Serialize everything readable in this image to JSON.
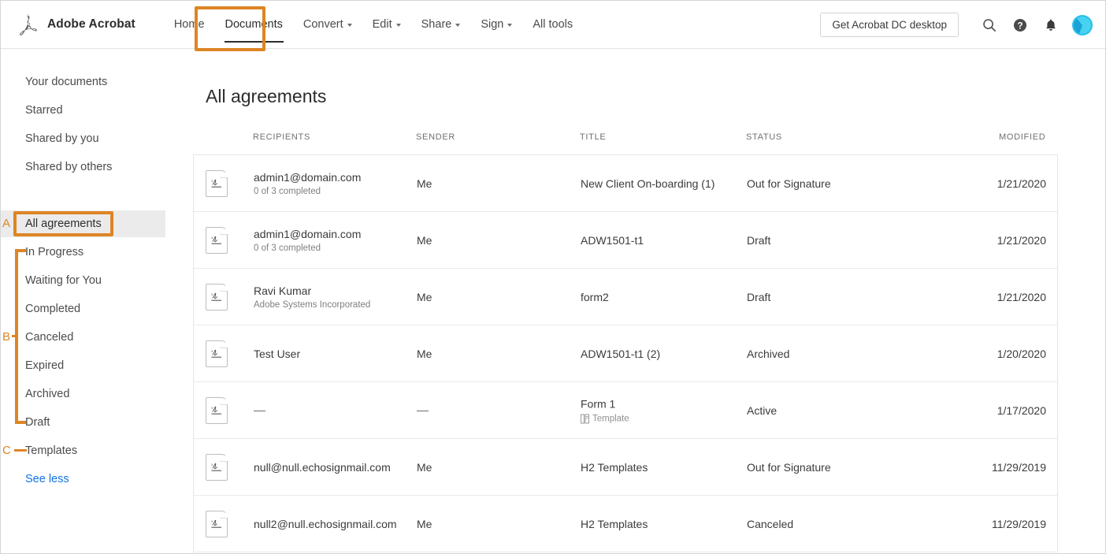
{
  "header": {
    "brand": "Adobe Acrobat",
    "logo_icon": "acrobat-logo-icon",
    "nav": [
      {
        "label": "Home",
        "has_caret": false,
        "active": false
      },
      {
        "label": "Documents",
        "has_caret": false,
        "active": true
      },
      {
        "label": "Convert",
        "has_caret": true,
        "active": false
      },
      {
        "label": "Edit",
        "has_caret": true,
        "active": false
      },
      {
        "label": "Share",
        "has_caret": true,
        "active": false
      },
      {
        "label": "Sign",
        "has_caret": true,
        "active": false
      },
      {
        "label": "All tools",
        "has_caret": false,
        "active": false
      }
    ],
    "get_desktop_label": "Get Acrobat DC desktop",
    "icons": [
      "search-icon",
      "help-icon",
      "bell-icon",
      "avatar"
    ]
  },
  "sidebar": {
    "items": [
      {
        "label": "Your documents",
        "selected": false,
        "link": false
      },
      {
        "label": "Starred",
        "selected": false,
        "link": false
      },
      {
        "label": "Shared by you",
        "selected": false,
        "link": false
      },
      {
        "label": "Shared by others",
        "selected": false,
        "link": false
      },
      {
        "label": "All agreements",
        "selected": true,
        "link": false
      },
      {
        "label": "In Progress",
        "selected": false,
        "link": false
      },
      {
        "label": "Waiting for You",
        "selected": false,
        "link": false
      },
      {
        "label": "Completed",
        "selected": false,
        "link": false
      },
      {
        "label": "Canceled",
        "selected": false,
        "link": false
      },
      {
        "label": "Expired",
        "selected": false,
        "link": false
      },
      {
        "label": "Archived",
        "selected": false,
        "link": false
      },
      {
        "label": "Draft",
        "selected": false,
        "link": false
      },
      {
        "label": "Templates",
        "selected": false,
        "link": false
      },
      {
        "label": "See less",
        "selected": false,
        "link": true
      }
    ]
  },
  "main": {
    "title": "All agreements",
    "columns": {
      "recipients": "RECIPIENTS",
      "sender": "SENDER",
      "title": "TITLE",
      "status": "STATUS",
      "modified": "MODIFIED"
    },
    "rows": [
      {
        "icon": "agreement-doc-icon",
        "recipient": "admin1@domain.com",
        "recipient_sub": "0 of 3 completed",
        "sender": "Me",
        "title": "New Client On-boarding (1)",
        "title_sub": "",
        "status": "Out for Signature",
        "modified": "1/21/2020"
      },
      {
        "icon": "agreement-doc-icon",
        "recipient": "admin1@domain.com",
        "recipient_sub": "0 of 3 completed",
        "sender": "Me",
        "title": "ADW1501-t1",
        "title_sub": "",
        "status": "Draft",
        "modified": "1/21/2020"
      },
      {
        "icon": "agreement-doc-icon",
        "recipient": "Ravi Kumar",
        "recipient_sub": "Adobe Systems Incorporated",
        "sender": "Me",
        "title": "form2",
        "title_sub": "",
        "status": "Draft",
        "modified": "1/21/2020"
      },
      {
        "icon": "agreement-doc-icon",
        "recipient": "Test User",
        "recipient_sub": "",
        "sender": "Me",
        "title": "ADW1501-t1 (2)",
        "title_sub": "",
        "status": "Archived",
        "modified": "1/20/2020"
      },
      {
        "icon": "agreement-doc-icon",
        "recipient": "—",
        "recipient_sub": "",
        "sender": "—",
        "title": "Form 1",
        "title_sub": "Template",
        "status": "Active",
        "modified": "1/17/2020"
      },
      {
        "icon": "agreement-doc-icon",
        "recipient": "null@null.echosignmail.com",
        "recipient_sub": "",
        "sender": "Me",
        "title": "H2 Templates",
        "title_sub": "",
        "status": "Out for Signature",
        "modified": "11/29/2019"
      },
      {
        "icon": "agreement-doc-icon",
        "recipient": "null2@null.echosignmail.com",
        "recipient_sub": "",
        "sender": "Me",
        "title": "H2 Templates",
        "title_sub": "",
        "status": "Canceled",
        "modified": "11/29/2019"
      }
    ]
  },
  "annotations": {
    "color": "#dd8524",
    "labels": {
      "a": "A",
      "b": "B",
      "c": "C"
    }
  }
}
